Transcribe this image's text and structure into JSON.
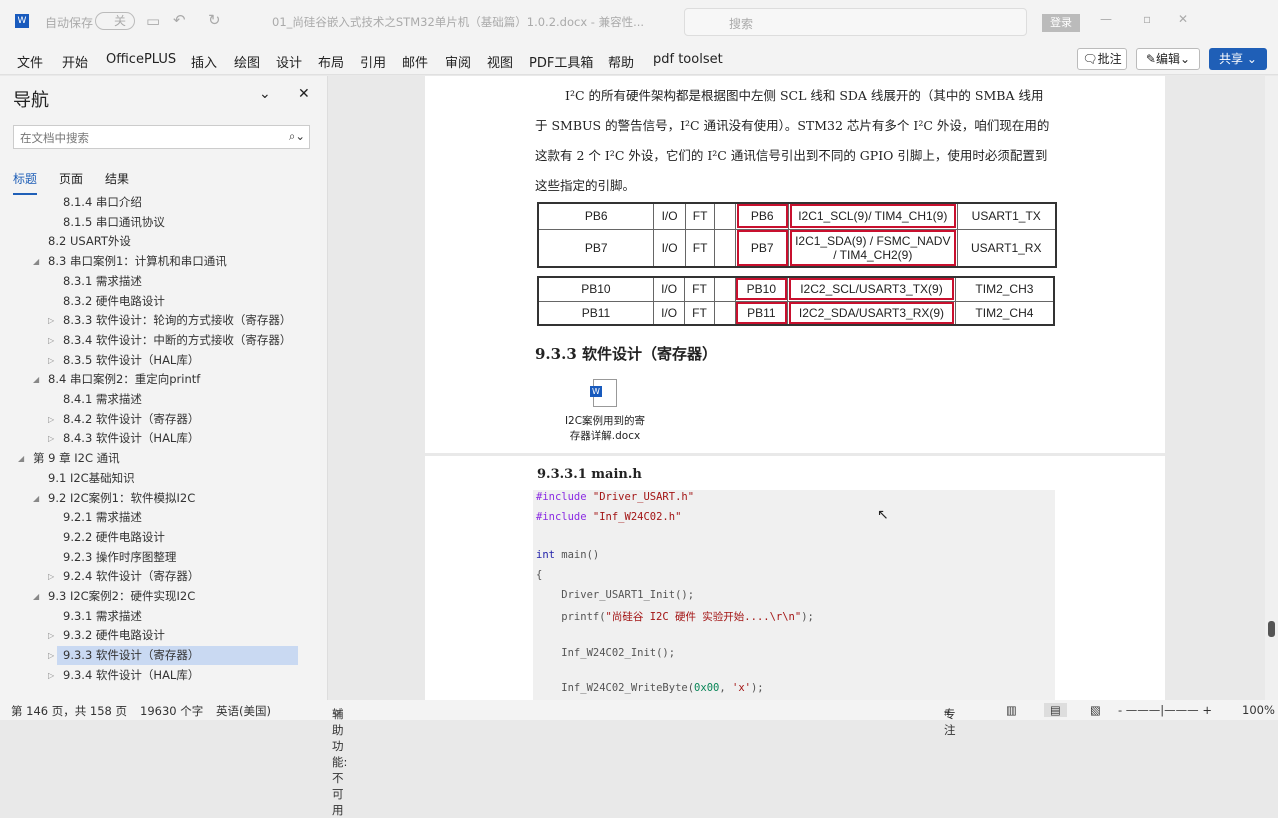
{
  "titlebar": {
    "autosave_label": "自动保存",
    "autosave_state": "关",
    "doc_title": "01_尚硅谷嵌入式技术之STM32单片机（基础篇）1.0.2.docx  -  兼容性...",
    "search_placeholder": "搜索",
    "login": "登录"
  },
  "ribbon": {
    "tabs": [
      "文件",
      "开始",
      "OfficePLUS",
      "插入",
      "绘图",
      "设计",
      "布局",
      "引用",
      "邮件",
      "审阅",
      "视图",
      "PDF工具箱",
      "帮助",
      "pdf toolset"
    ],
    "comment": "批注",
    "edit": "编辑",
    "share": "共享"
  },
  "nav": {
    "title": "导航",
    "search_placeholder": "在文档中搜索",
    "tabs": [
      "标题",
      "页面",
      "结果"
    ],
    "items": [
      {
        "label": "8.1.4 串口介绍",
        "level": 3,
        "arrow": ""
      },
      {
        "label": "8.1.5 串口通讯协议",
        "level": 3,
        "arrow": ""
      },
      {
        "label": "8.2 USART外设",
        "level": 2,
        "arrow": ""
      },
      {
        "label": "8.3 串口案例1：计算机和串口通讯",
        "level": 2,
        "arrow": "◢"
      },
      {
        "label": "8.3.1 需求描述",
        "level": 3,
        "arrow": ""
      },
      {
        "label": "8.3.2 硬件电路设计",
        "level": 3,
        "arrow": ""
      },
      {
        "label": "8.3.3 软件设计：轮询的方式接收（寄存器）",
        "level": 3,
        "arrow": "▷"
      },
      {
        "label": "8.3.4 软件设计：中断的方式接收（寄存器）",
        "level": 3,
        "arrow": "▷"
      },
      {
        "label": "8.3.5 软件设计（HAL库）",
        "level": 3,
        "arrow": "▷"
      },
      {
        "label": "8.4 串口案例2：重定向printf",
        "level": 2,
        "arrow": "◢"
      },
      {
        "label": "8.4.1 需求描述",
        "level": 3,
        "arrow": ""
      },
      {
        "label": "8.4.2 软件设计（寄存器）",
        "level": 3,
        "arrow": "▷"
      },
      {
        "label": "8.4.3 软件设计（HAL库）",
        "level": 3,
        "arrow": "▷"
      },
      {
        "label": "第 9 章 I2C 通讯",
        "level": 1,
        "arrow": "◢"
      },
      {
        "label": "9.1 I2C基础知识",
        "level": 2,
        "arrow": ""
      },
      {
        "label": "9.2 I2C案例1：软件模拟I2C",
        "level": 2,
        "arrow": "◢"
      },
      {
        "label": "9.2.1 需求描述",
        "level": 3,
        "arrow": ""
      },
      {
        "label": "9.2.2 硬件电路设计",
        "level": 3,
        "arrow": ""
      },
      {
        "label": "9.2.3 操作时序图整理",
        "level": 3,
        "arrow": ""
      },
      {
        "label": "9.2.4 软件设计（寄存器）",
        "level": 3,
        "arrow": "▷"
      },
      {
        "label": "9.3 I2C案例2：硬件实现I2C",
        "level": 2,
        "arrow": "◢"
      },
      {
        "label": "9.3.1 需求描述",
        "level": 3,
        "arrow": ""
      },
      {
        "label": "9.3.2 硬件电路设计",
        "level": 3,
        "arrow": "▷"
      },
      {
        "label": "9.3.3 软件设计（寄存器）",
        "level": 3,
        "arrow": "▷",
        "selected": true
      },
      {
        "label": "9.3.4 软件设计（HAL库）",
        "level": 3,
        "arrow": "▷"
      }
    ]
  },
  "doc": {
    "para": [
      "I²C 的所有硬件架构都是根据图中左侧 SCL 线和 SDA 线展开的（其中的 SMBA 线用",
      "于 SMBUS 的警告信号，I²C 通讯没有使用）。STM32 芯片有多个 I²C 外设，咱们现在用的",
      "这款有 2 个 I²C 外设，它们的 I²C 通讯信号引出到不同的 GPIO 引脚上，使用时必须配置到",
      "这些指定的引脚。"
    ],
    "table1": [
      [
        "PB6",
        "I/O",
        "FT",
        "",
        "PB6",
        "I2C1_SCL(9)/ TIM4_CH1(9)",
        "USART1_TX"
      ],
      [
        "PB7",
        "I/O",
        "FT",
        "",
        "PB7",
        "I2C1_SDA(9) / FSMC_NADV / TIM4_CH2(9)",
        "USART1_RX"
      ]
    ],
    "table2": [
      [
        "PB10",
        "I/O",
        "FT",
        "",
        "PB10",
        "I2C2_SCL/USART3_TX(9)",
        "TIM2_CH3"
      ],
      [
        "PB11",
        "I/O",
        "FT",
        "",
        "PB11",
        "I2C2_SDA/USART3_RX(9)",
        "TIM2_CH4"
      ]
    ],
    "heading": "9.3.3 软件设计（寄存器）",
    "attachment": "I2C案例用到的寄存器详解.docx",
    "subheading": "9.3.3.1 main.h",
    "code": {
      "l1a": "#include",
      "l1b": " \"Driver_USART.h\"",
      "l2a": "#include",
      "l2b": " \"Inf_W24C02.h\"",
      "l3a": "int",
      "l3b": " main()",
      "l4": "{",
      "l5": "    Driver_USART1_Init();",
      "l6a": "    printf(",
      "l6b": "\"尚硅谷 I2C 硬件 实验开始....\\r\\n\"",
      "l6c": ");",
      "l7": "    Inf_W24C02_Init();",
      "l8a": "    Inf_W24C02_WriteByte(",
      "l8b": "0x00",
      "l8c": ", ",
      "l8d": "'x'",
      "l8e": ");"
    }
  },
  "status": {
    "page": "第 146 页，共 158 页",
    "words": "19630 个字",
    "lang": "英语(美国)",
    "access": "辅助功能: 不可用",
    "focus": "专注",
    "zoom": "100%"
  }
}
